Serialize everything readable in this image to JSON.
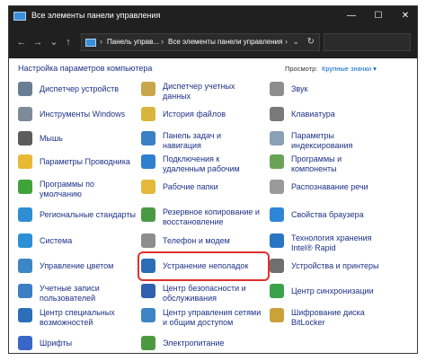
{
  "window": {
    "title": "Все элементы панели управления",
    "minimize_glyph": "—",
    "maximize_glyph": "☐",
    "close_glyph": "✕"
  },
  "address": {
    "back_glyph": "←",
    "forward_glyph": "→",
    "recent_glyph": "⌄",
    "up_glyph": "↑",
    "crumbs": [
      "Панель управ...",
      "Все элементы панели управления"
    ],
    "separator_glyph": "›",
    "dropdown_glyph": "⌄",
    "refresh_glyph": "↻",
    "search_placeholder": ""
  },
  "header": {
    "title": "Настройка параметров компьютера",
    "view_by_label": "Просмотр:",
    "view_by_value": "Крупные значки ▾"
  },
  "items": {
    "col1": [
      {
        "label": "Диспетчер устройств",
        "icon": "device-manager-icon",
        "color": "#6a7f95"
      },
      {
        "label": "Инструменты Windows",
        "icon": "windows-tools-icon",
        "color": "#7d8b99"
      },
      {
        "label": "Мышь",
        "icon": "mouse-icon",
        "color": "#5c5c5c"
      },
      {
        "label": "Параметры Проводника",
        "icon": "explorer-options-icon",
        "color": "#e8b935"
      },
      {
        "label": "Программы по\nумолчанию",
        "icon": "default-programs-icon",
        "color": "#3fa33c"
      },
      {
        "label": "Региональные стандарты",
        "icon": "region-icon",
        "color": "#2f8ed1"
      },
      {
        "label": "Система",
        "icon": "system-icon",
        "color": "#2d8fd6"
      },
      {
        "label": "Управление цветом",
        "icon": "color-management-icon",
        "color": "#3d86c6"
      },
      {
        "label": "Учетные записи\nпользователей",
        "icon": "user-accounts-icon",
        "color": "#3b7fc4"
      },
      {
        "label": "Центр специальных\nвозможностей",
        "icon": "ease-of-access-icon",
        "color": "#2a6fb8"
      },
      {
        "label": "Шрифты",
        "icon": "fonts-icon",
        "color": "#3a66c9"
      }
    ],
    "col2": [
      {
        "label": "Диспетчер учетных\nданных",
        "icon": "credential-manager-icon",
        "color": "#c7a74a"
      },
      {
        "label": "История файлов",
        "icon": "file-history-icon",
        "color": "#d9b53e"
      },
      {
        "label": "Панель задач и\nнавигация",
        "icon": "taskbar-icon",
        "color": "#3b7fc4"
      },
      {
        "label": "Подключения к\nудаленным рабочим",
        "icon": "remote-connection-icon",
        "color": "#2f7fd1"
      },
      {
        "label": "Рабочие папки",
        "icon": "work-folders-icon",
        "color": "#e4b93c"
      },
      {
        "label": "Резервное копирование и\nвосстановление",
        "icon": "backup-icon",
        "color": "#4a9a45"
      },
      {
        "label": "Телефон и модем",
        "icon": "phone-modem-icon",
        "color": "#8d8d8d"
      },
      {
        "label": "Устранение неполадок",
        "icon": "troubleshooting-icon",
        "color": "#2c6db5"
      },
      {
        "label": "Центр безопасности и\nобслуживания",
        "icon": "security-center-icon",
        "color": "#2f5fae"
      },
      {
        "label": "Центр управления сетями\nи общим доступом",
        "icon": "network-center-icon",
        "color": "#3d85c6"
      },
      {
        "label": "Электропитание",
        "icon": "power-options-icon",
        "color": "#4c9a3f"
      }
    ],
    "col3": [
      {
        "label": "Звук",
        "icon": "sound-icon",
        "color": "#8e8e8e"
      },
      {
        "label": "Клавиатура",
        "icon": "keyboard-icon",
        "color": "#7a7a7a"
      },
      {
        "label": "Параметры\nиндексирования",
        "icon": "indexing-icon",
        "color": "#8aa0b5"
      },
      {
        "label": "Программы и\nкомпоненты",
        "icon": "programs-features-icon",
        "color": "#6aa355"
      },
      {
        "label": "Распознавание речи",
        "icon": "speech-icon",
        "color": "#9a9a9a"
      },
      {
        "label": "Свойства браузера",
        "icon": "internet-options-icon",
        "color": "#2f86d6"
      },
      {
        "label": "Технология хранения\nIntel® Rapid",
        "icon": "intel-rapid-icon",
        "color": "#2a74c4"
      },
      {
        "label": "Устройства и принтеры",
        "icon": "devices-printers-icon",
        "color": "#6f6f6f"
      },
      {
        "label": "Центр синхронизации",
        "icon": "sync-center-icon",
        "color": "#3aa34a"
      },
      {
        "label": "Шифрование диска\nBitLocker",
        "icon": "bitlocker-icon",
        "color": "#c9a23a"
      }
    ]
  },
  "highlight_color": "#e0302d"
}
